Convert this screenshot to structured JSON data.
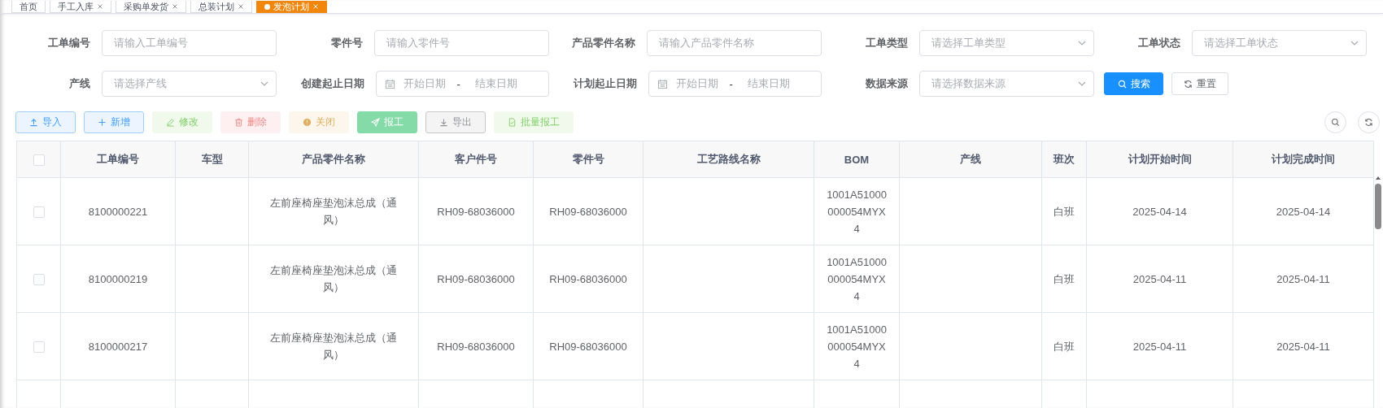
{
  "tabs": [
    {
      "label": "首页",
      "active": false,
      "closable": false
    },
    {
      "label": "手工入库",
      "active": false,
      "closable": true
    },
    {
      "label": "采购单发货",
      "active": false,
      "closable": true
    },
    {
      "label": "总装计划",
      "active": false,
      "closable": true
    },
    {
      "label": "发泡计划",
      "active": true,
      "closable": true
    }
  ],
  "filters": [
    {
      "label": "工单编号",
      "kind": "text",
      "placeholder": "请输入工单编号"
    },
    {
      "label": "零件号",
      "kind": "text",
      "placeholder": "请输入零件号"
    },
    {
      "label": "产品零件名称",
      "kind": "text",
      "placeholder": "请输入产品零件名称"
    },
    {
      "label": "工单类型",
      "kind": "select",
      "placeholder": "请选择工单类型"
    },
    {
      "label": "工单状态",
      "kind": "select",
      "placeholder": "请选择工单状态"
    },
    {
      "label": "产线",
      "kind": "select",
      "placeholder": "请选择产线"
    },
    {
      "label": "创建起止日期",
      "kind": "daterange",
      "start_placeholder": "开始日期",
      "separator": "-",
      "end_placeholder": "结束日期"
    },
    {
      "label": "计划起止日期",
      "kind": "daterange",
      "start_placeholder": "开始日期",
      "separator": "-",
      "end_placeholder": "结束日期"
    },
    {
      "label": "数据来源",
      "kind": "select",
      "placeholder": "请选择数据来源"
    }
  ],
  "filter_buttons": [
    {
      "label": "搜索",
      "kind": "primary"
    },
    {
      "label": "重置",
      "kind": "default"
    }
  ],
  "toolbar": [
    {
      "label": "导入",
      "kind": "primary",
      "disabled": false
    },
    {
      "label": "新增",
      "kind": "primary",
      "disabled": false
    },
    {
      "label": "修改",
      "kind": "success",
      "disabled": true
    },
    {
      "label": "删除",
      "kind": "danger",
      "disabled": true
    },
    {
      "label": "关闭",
      "kind": "warning",
      "disabled": true
    },
    {
      "label": "报工",
      "kind": "solid",
      "disabled": true
    },
    {
      "label": "导出",
      "kind": "info",
      "disabled": false
    },
    {
      "label": "批量报工",
      "kind": "success",
      "disabled": true
    }
  ],
  "table": {
    "header_checked": false,
    "columns": [
      "工单编号",
      "车型",
      "产品零件名称",
      "客户件号",
      "零件号",
      "工艺路线名称",
      "BOM",
      "产线",
      "班次",
      "计划开始时间",
      "计划完成时间"
    ],
    "rows": [
      {
        "checked": false,
        "cells": [
          "8100000221",
          "",
          "左前座椅座垫泡沫总成（通风）",
          "RH09-68036000",
          "RH09-68036000",
          "",
          "1001A51000000054MYX4",
          "",
          "白班",
          "2025-04-14",
          "2025-04-14"
        ]
      },
      {
        "checked": false,
        "cells": [
          "8100000219",
          "",
          "左前座椅座垫泡沫总成（通风）",
          "RH09-68036000",
          "RH09-68036000",
          "",
          "1001A51000000054MYX4",
          "",
          "白班",
          "2025-04-11",
          "2025-04-11"
        ]
      },
      {
        "checked": false,
        "cells": [
          "8100000217",
          "",
          "左前座椅座垫泡沫总成（通风）",
          "RH09-68036000",
          "RH09-68036000",
          "",
          "1001A51000000054MYX4",
          "",
          "白班",
          "2025-04-11",
          "2025-04-11"
        ]
      }
    ]
  }
}
